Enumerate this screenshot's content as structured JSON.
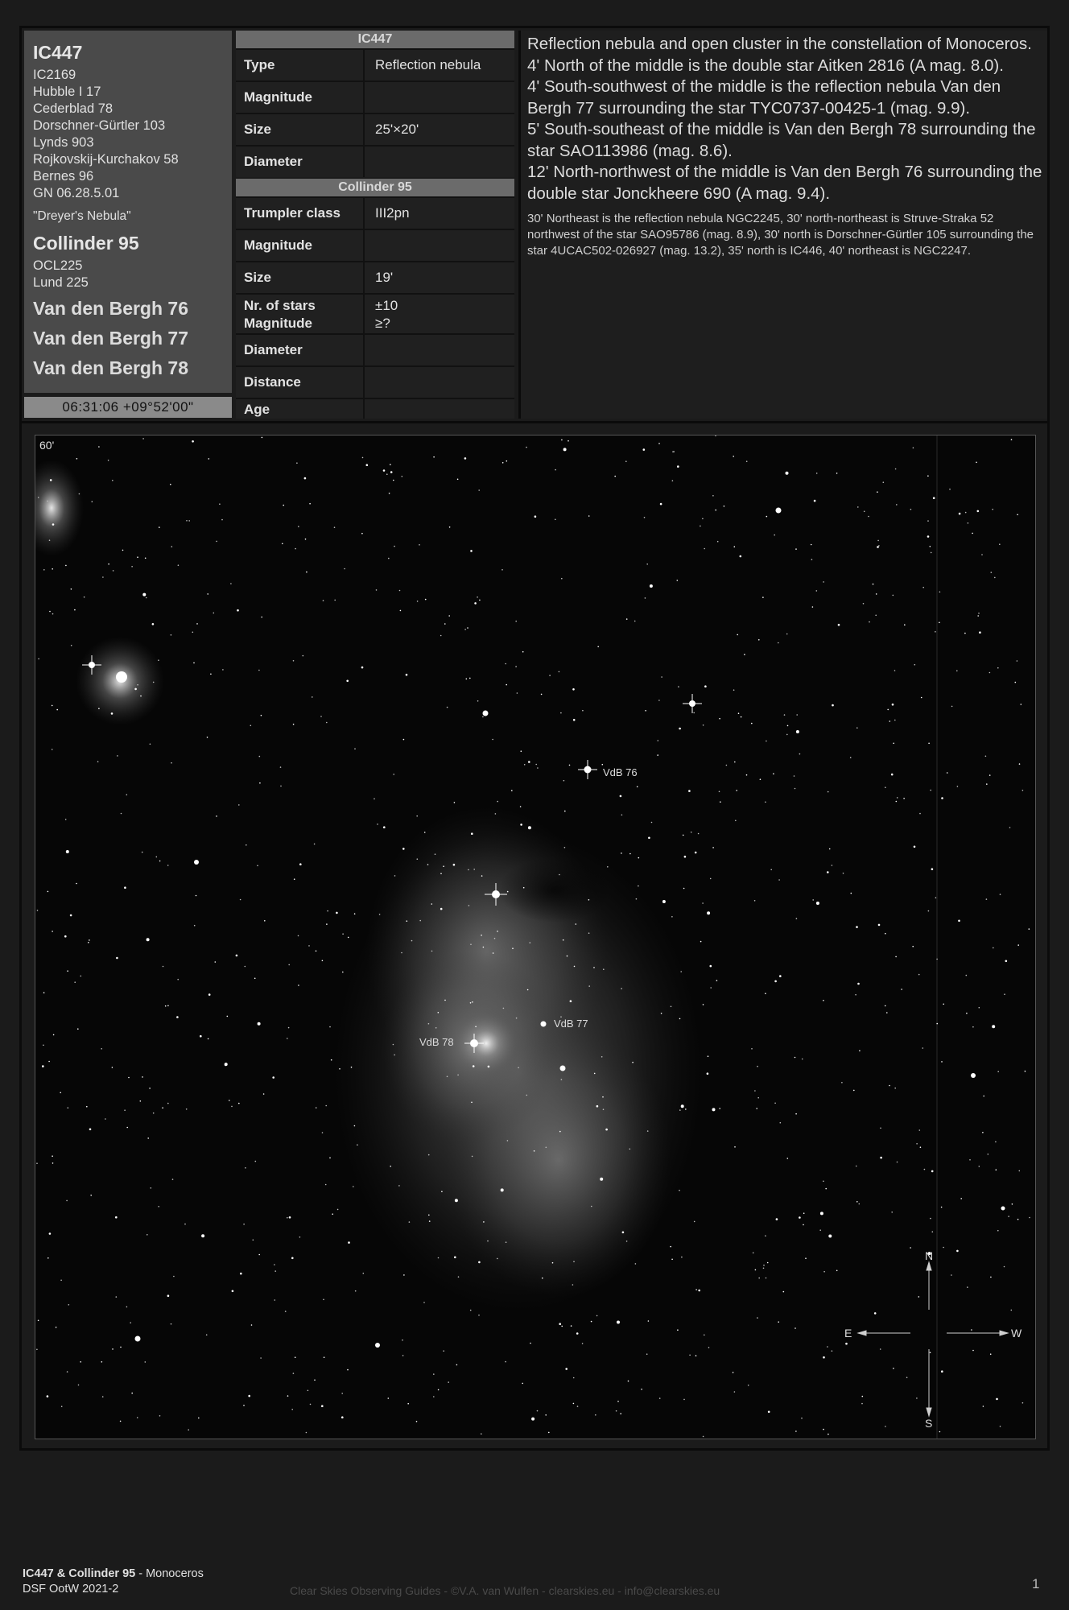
{
  "main_object": {
    "name": "IC447",
    "alt_names": [
      "IC2169",
      "Hubble I 17",
      "Cederblad 78",
      "Dorschner-Gürtler 103",
      "Lynds 903",
      "Rojkovskij-Kurchakov 58",
      "Bernes 96",
      "GN 06.28.5.01"
    ],
    "nickname": "\"Dreyer's Nebula\""
  },
  "second_object": {
    "name": "Collinder 95",
    "alt_names": [
      "OCL225",
      "Lund 225"
    ]
  },
  "extra_objects": [
    "Van den Bergh 76",
    "Van den Bergh 77",
    "Van den Bergh 78"
  ],
  "coordinates": "06:31:06 +09°52'00\"",
  "table1": {
    "title": "IC447",
    "rows": [
      {
        "key": "Type",
        "value": "Reflection nebula"
      },
      {
        "key": "Magnitude",
        "value": ""
      },
      {
        "key": "Size",
        "value": "25'×20'"
      },
      {
        "key": "Diameter",
        "value": ""
      }
    ]
  },
  "table2": {
    "title": "Collinder 95",
    "rows": [
      {
        "key": "Trumpler class",
        "value": "III2pn"
      },
      {
        "key": "Magnitude",
        "value": ""
      },
      {
        "key": "Size",
        "value": "19'"
      },
      {
        "key": "Nr. of stars",
        "key2": "Magnitude",
        "value": "±10",
        "value2": "≥?"
      },
      {
        "key": "Diameter",
        "value": ""
      },
      {
        "key": "Distance",
        "value": ""
      },
      {
        "key": "Age",
        "value": ""
      }
    ]
  },
  "description": [
    "Reflection nebula and open cluster in the constellation of Monoceros.",
    "4' North of the middle is the double star Aitken 2816 (A mag. 8.0).",
    "4' South-southwest of the middle is the reflection nebula Van den Bergh 77 surrounding the star TYC0737-00425-1 (mag. 9.9).",
    "5' South-southeast of the middle is Van den Bergh 78 surrounding the star SAO113986 (mag. 8.6).",
    "12' North-northwest of the middle is Van den Bergh 76 surrounding the double star Jonckheere 690 (A mag. 9.4)."
  ],
  "description_small": "30' Northeast is the reflection nebula NGC2245, 30' north-northeast is Struve-Straka 52 northwest of the star SAO95786 (mag. 8.9), 30' north is Dorschner-Gürtler 105 surrounding the star 4UCAC502-026927 (mag. 13.2), 35' north is IC446, 40' northeast is NGC2247.",
  "image": {
    "scale_label": "60'",
    "labels": {
      "vdb76": "VdB 76",
      "vdb77": "VdB 77",
      "vdb78": "VdB 78"
    },
    "compass": {
      "n": "N",
      "s": "S",
      "e": "E",
      "w": "W"
    }
  },
  "footer": {
    "title_bold": "IC447 & Collinder 95",
    "title_rest": " - Monoceros",
    "subtitle": "DSF OotW 2021-2",
    "credits": "Clear Skies Observing Guides - ©V.A. van Wulfen - clearskies.eu - info@clearskies.eu",
    "page_number": "1"
  }
}
